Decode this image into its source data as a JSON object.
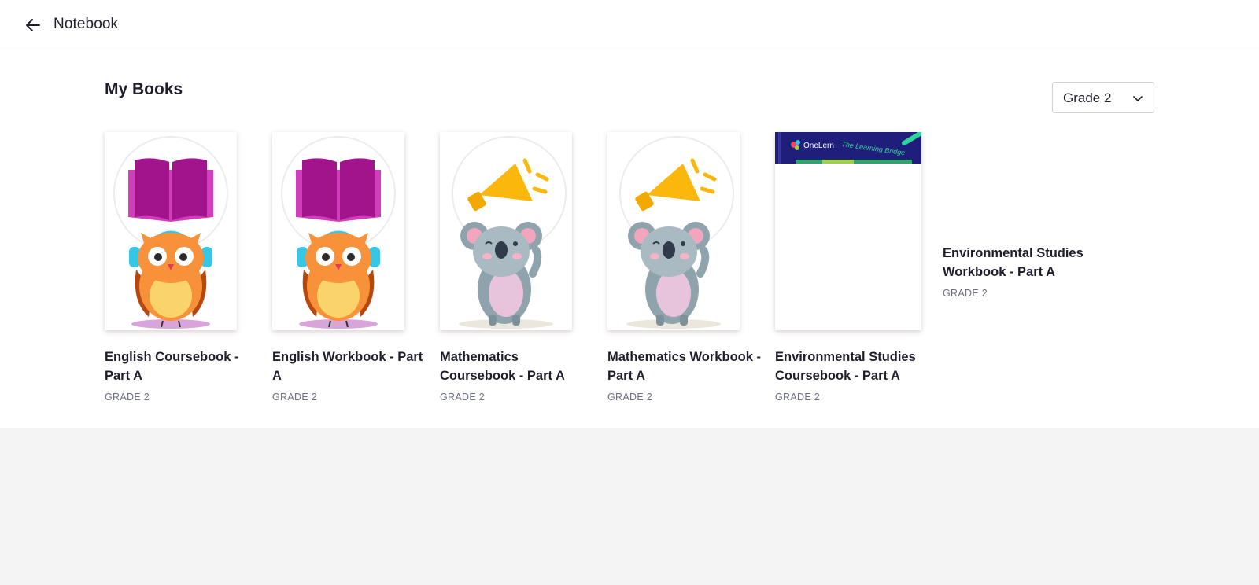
{
  "header": {
    "title": "Notebook",
    "back_icon": "arrow-left-icon"
  },
  "main": {
    "section_title": "My Books",
    "grade_filter": {
      "selected": "Grade 2"
    },
    "books": [
      {
        "title": "English Coursebook - Part A",
        "grade": "GRADE 2",
        "cover": "owl-book-illustration"
      },
      {
        "title": "English Workbook - Part A",
        "grade": "GRADE 2",
        "cover": "owl-book-illustration"
      },
      {
        "title": "Mathematics Coursebook - Part A",
        "grade": "GRADE 2",
        "cover": "koala-megaphone-illustration"
      },
      {
        "title": "Mathematics Workbook - Part A",
        "grade": "GRADE 2",
        "cover": "koala-megaphone-illustration"
      },
      {
        "title": "Environmental Studies Coursebook - Part A",
        "grade": "GRADE 2",
        "cover": "onelern-cover",
        "cover_brand": "OneLern",
        "cover_tagline": "The Learning Bridge"
      },
      {
        "title": "Environmental Studies Workbook - Part A",
        "grade": "GRADE 2",
        "cover": "none"
      }
    ]
  },
  "colors": {
    "book_purple": "#a2148c",
    "owl_orange": "#f7923a",
    "megaphone_yellow": "#fbb70c",
    "koala_grey": "#8fa3ad",
    "onelern_navy": "#1f1e7a"
  }
}
